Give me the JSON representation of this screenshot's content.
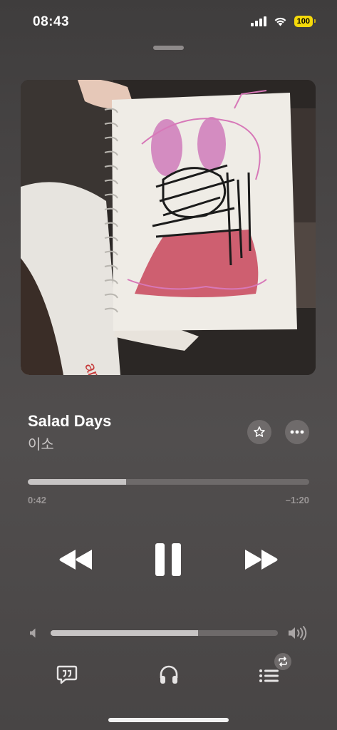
{
  "status_bar": {
    "time": "08:43",
    "battery": "100"
  },
  "now_playing": {
    "title": "Salad Days",
    "artist": "이소"
  },
  "playback": {
    "elapsed": "0:42",
    "remaining": "–1:20",
    "progress": 0.35
  },
  "volume": {
    "level": 0.65
  },
  "icons": {
    "signal": "cellular-signal-icon",
    "wifi": "wifi-icon",
    "battery": "battery-icon",
    "favorite": "star-icon",
    "more": "ellipsis-icon",
    "rewind": "rewind-icon",
    "pause": "pause-icon",
    "forward": "fast-forward-icon",
    "volume_low": "speaker-low-icon",
    "volume_high": "speaker-high-icon",
    "lyrics": "lyrics-icon",
    "airplay": "headphones-icon",
    "queue": "queue-icon",
    "repeat": "repeat-icon"
  },
  "colors": {
    "background": "#4b4848",
    "accent_battery": "#f5d90a",
    "track_fill": "#c7c4c4"
  }
}
